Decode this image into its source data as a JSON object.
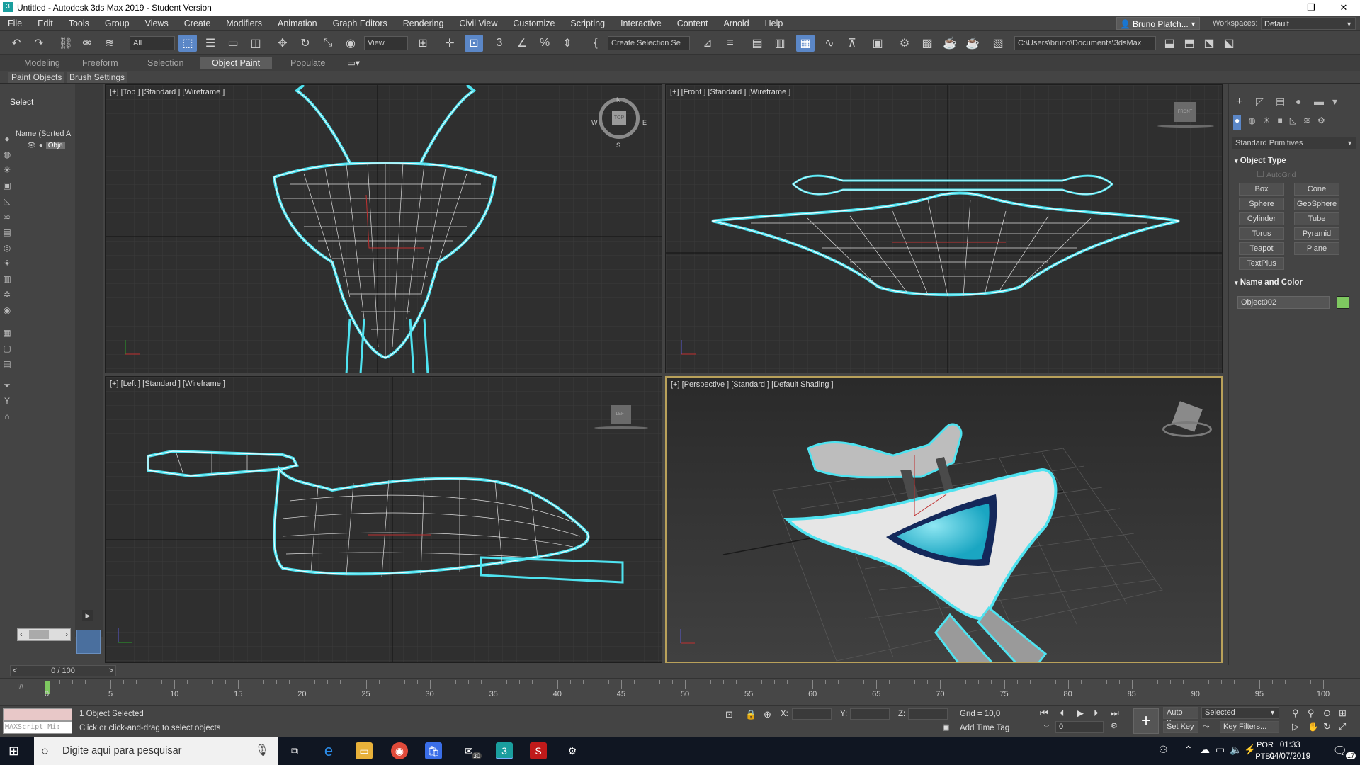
{
  "window": {
    "title": "Untitled - Autodesk 3ds Max 2019 - Student Version",
    "minimize_icon": "minimize-icon",
    "maximize_icon": "restore-icon",
    "close_icon": "close-icon"
  },
  "menu": [
    "File",
    "Edit",
    "Tools",
    "Group",
    "Views",
    "Create",
    "Modifiers",
    "Animation",
    "Graph Editors",
    "Rendering",
    "Civil View",
    "Customize",
    "Scripting",
    "Interactive",
    "Content",
    "Arnold",
    "Help"
  ],
  "user": {
    "name": "Bruno Platch...",
    "workspaces_label": "Workspaces:",
    "workspace": "Default"
  },
  "toolbar": {
    "selection_filter": "All",
    "ref_coord": "View",
    "named_selection": "Create Selection Se",
    "path": "C:\\Users\\bruno\\Documents\\3dsMax"
  },
  "ribbon": {
    "tabs": [
      "Modeling",
      "Freeform",
      "Selection",
      "Object Paint",
      "Populate"
    ],
    "active": "Object Paint",
    "sub": [
      "Paint Objects",
      "Brush Settings"
    ]
  },
  "scene_explorer": {
    "mode": "Select",
    "header": "Name (Sorted A",
    "item": "Obje"
  },
  "viewports": [
    {
      "label": "[+] [Top ] [Standard ] [Wireframe ]"
    },
    {
      "label": "[+] [Front ] [Standard ] [Wireframe ]"
    },
    {
      "label": "[+] [Left ] [Standard ] [Wireframe ]"
    },
    {
      "label": "[+] [Perspective ] [Standard ] [Default Shading ]"
    }
  ],
  "compass": {
    "n": "N",
    "s": "S",
    "e": "E",
    "w": "W",
    "center": "TOP"
  },
  "viewcube": {
    "front": "FRONT",
    "left": "LEFT"
  },
  "command_panel": {
    "dropdown": "Standard Primitives",
    "object_type_title": "Object Type",
    "autogrid": "AutoGrid",
    "buttons": [
      "Box",
      "Cone",
      "Sphere",
      "GeoSphere",
      "Cylinder",
      "Tube",
      "Torus",
      "Pyramid",
      "Teapot",
      "Plane",
      "TextPlus"
    ],
    "name_color_title": "Name and Color",
    "object_name": "Object002",
    "object_color": "#7ec860"
  },
  "time": {
    "slider": "0 / 100",
    "ticks": [
      "0",
      "5",
      "10",
      "15",
      "20",
      "25",
      "30",
      "35",
      "40",
      "45",
      "50",
      "55",
      "60",
      "65",
      "70",
      "75",
      "80",
      "85",
      "90",
      "95",
      "100"
    ]
  },
  "status": {
    "maxscript": "MAXScript Mi:",
    "selected": "1 Object Selected",
    "prompt": "Click or click-and-drag to select objects",
    "x_label": "X:",
    "y_label": "Y:",
    "z_label": "Z:",
    "grid": "Grid = 10,0",
    "add_time_tag": "Add Time Tag",
    "auto_key": "Auto Key",
    "selected_dropdown": "Selected",
    "set_key": "Set Key",
    "key_filters": "Key Filters...",
    "frame": "0"
  },
  "taskbar": {
    "search_placeholder": "Digite aqui para pesquisar",
    "lang1": "POR",
    "lang2": "PTB2",
    "time": "01:33",
    "date": "04/07/2019",
    "mail_badge": "30",
    "notif_badge": "17"
  },
  "colors": {
    "accent_blue": "#5b87c7",
    "selection_cyan": "#4fe3f0",
    "active_viewport": "#b9a15a"
  }
}
